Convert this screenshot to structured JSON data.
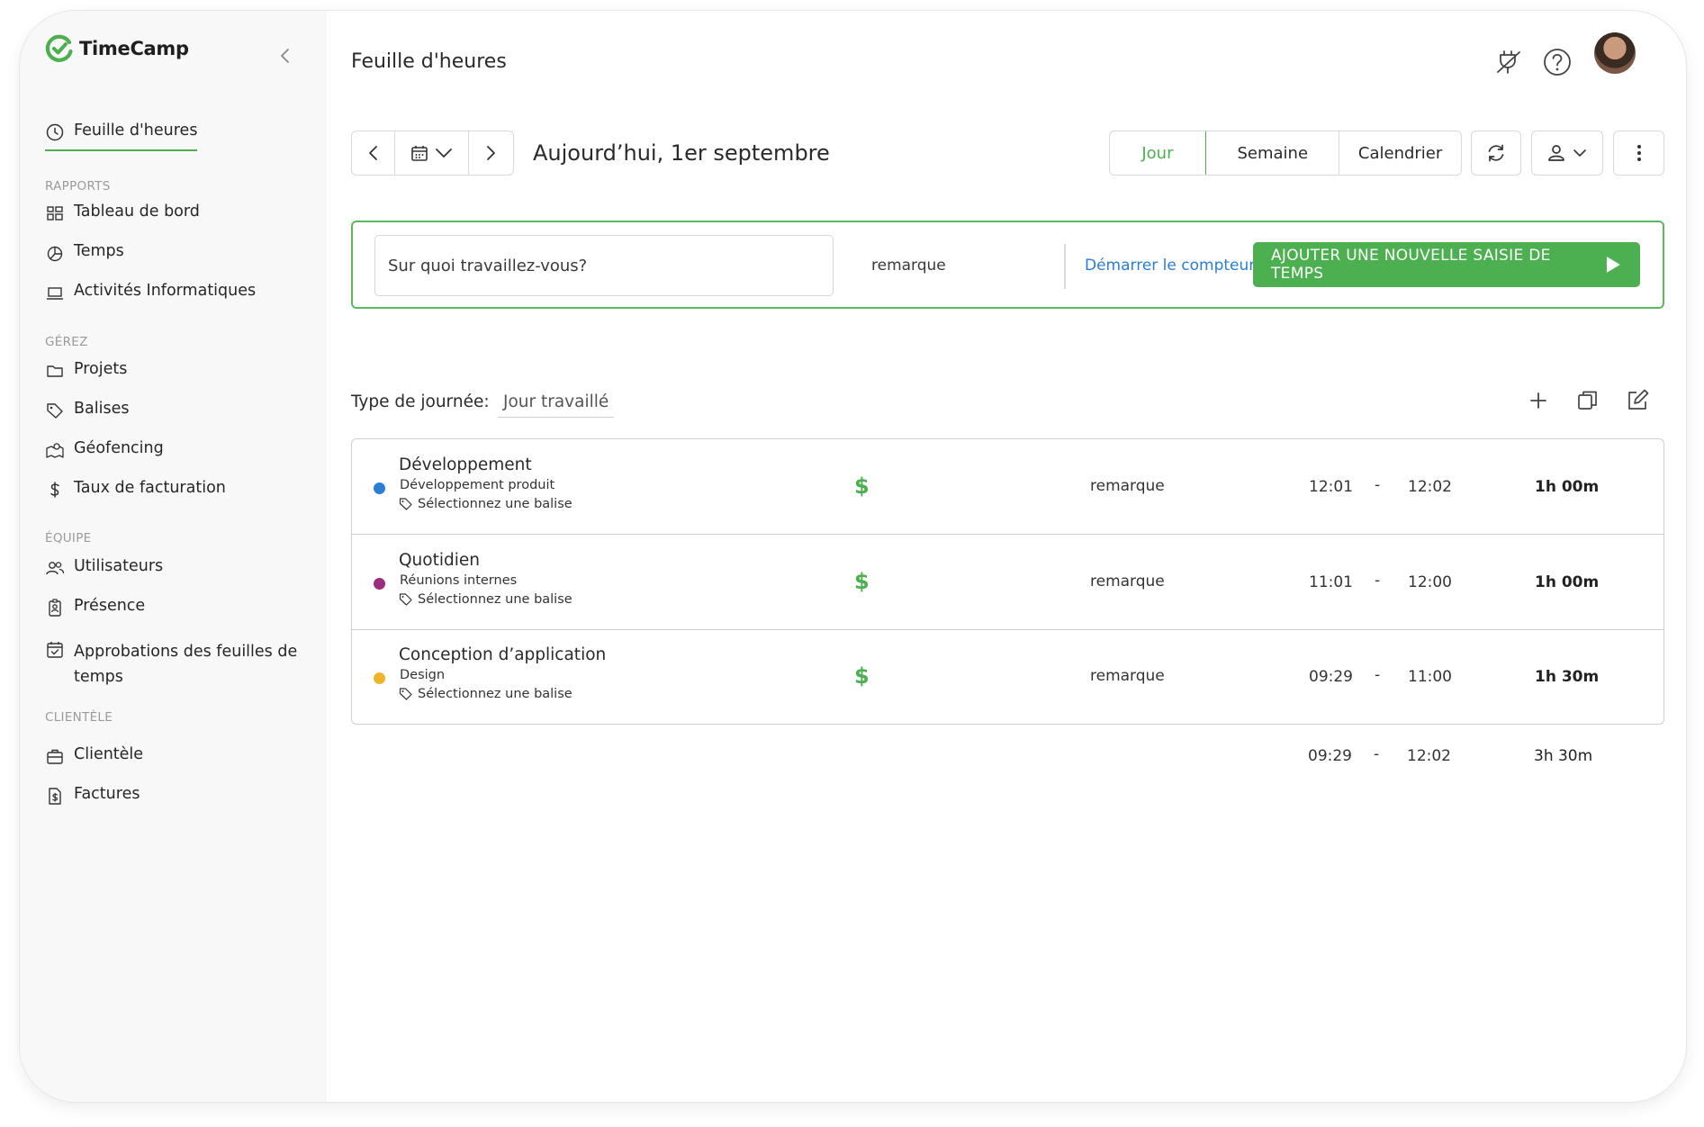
{
  "app": {
    "name": "TimeCamp",
    "accent": "#4caf50",
    "link": "#2a7fd4"
  },
  "sidebar": {
    "timesheet": "Feuille d'heures",
    "sections": [
      {
        "label": "RAPPORTS",
        "items": [
          "Tableau de bord",
          "Temps",
          "Activités Informatiques"
        ]
      },
      {
        "label": "GÉREZ",
        "items": [
          "Projets",
          "Balises",
          "Géofencing",
          "Taux de facturation"
        ]
      },
      {
        "label": "ÉQUIPE",
        "items": [
          "Utilisateurs",
          "Présence",
          "Approbations des feuilles de",
          "temps"
        ]
      },
      {
        "label": "CLIENTÈLE",
        "items": [
          "Clientèle",
          "Factures"
        ]
      }
    ]
  },
  "header": {
    "title": "Feuille d'heures"
  },
  "toolbar": {
    "date_label": "Aujourd’hui, 1er septembre",
    "views": [
      "Jour",
      "Semaine",
      "Calendrier"
    ],
    "active_view": "Jour"
  },
  "entry_bar": {
    "task_placeholder": "Sur quoi travaillez-vous?",
    "note_placeholder": "remarque",
    "start_timer": "Démarrer le compteur",
    "add_entry": "AJOUTER UNE NOUVELLE SAISIE DE TEMPS"
  },
  "day_type": {
    "label": "Type de journée:",
    "value": "Jour travaillé"
  },
  "entries": [
    {
      "project": "Développement",
      "task": "Développement produit",
      "tag": "Sélectionnez une balise",
      "color": "#2a7fd4",
      "billable": "$",
      "note": "remarque",
      "start": "12:01",
      "dash": "-",
      "end": "12:02",
      "duration": "1h 00m"
    },
    {
      "project": "Quotidien",
      "task": "Réunions internes",
      "tag": "Sélectionnez une balise",
      "color": "#9c2a7e",
      "billable": "$",
      "note": "remarque",
      "start": "11:01",
      "dash": "-",
      "end": "12:00",
      "duration": "1h 00m"
    },
    {
      "project": "Conception d’application",
      "task": "Design",
      "tag": "Sélectionnez une balise",
      "color": "#f0b429",
      "billable": "$",
      "note": "remarque",
      "start": "09:29",
      "dash": "-",
      "end": "11:00",
      "duration": "1h 30m"
    }
  ],
  "totals": {
    "start": "09:29",
    "dash": "-",
    "end": "12:02",
    "duration": "3h 30m"
  },
  "icons": {
    "collapse": "chevron-left-icon",
    "plugin": "plug-off-icon",
    "help": "help-circle-icon",
    "calendar": "calendar-icon",
    "refresh": "refresh-icon",
    "user_filter": "user-icon",
    "more": "more-vertical-icon",
    "add": "plus-icon",
    "copy": "copy-icon",
    "edit": "edit-icon",
    "tag": "tag-icon",
    "play": "play-icon"
  }
}
